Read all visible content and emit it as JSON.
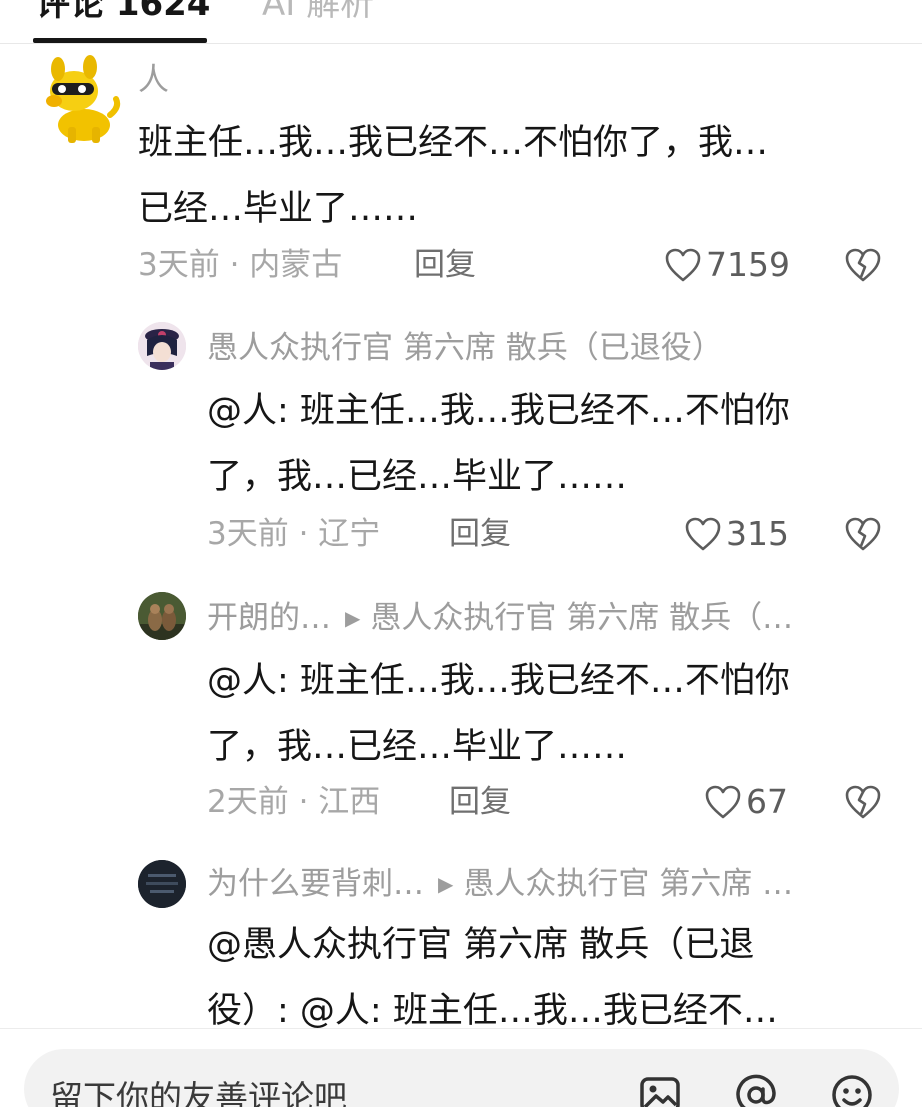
{
  "tabs": {
    "comments_label": "评论 1624",
    "ai_label": "AI 解析"
  },
  "comments": [
    {
      "username": "人",
      "text_lines": [
        "班主任…我…我已经不…不怕你了，我…",
        "已经…毕业了……"
      ],
      "time_location": "3天前 · 内蒙古",
      "reply_label": "回复",
      "likes": "7159"
    },
    {
      "username": "愚人众执行官 第六席 散兵（已退役）",
      "text_lines": [
        "@人: 班主任…我…我已经不…不怕你",
        "了，我…已经…毕业了……"
      ],
      "time_location": "3天前 · 辽宁",
      "reply_label": "回复",
      "likes": "315"
    },
    {
      "username": "开朗的…",
      "reply_to": "愚人众执行官 第六席 散兵（…",
      "text_lines": [
        "@人: 班主任…我…我已经不…不怕你",
        "了，我…已经…毕业了……"
      ],
      "time_location": "2天前 · 江西",
      "reply_label": "回复",
      "likes": "67"
    },
    {
      "username": "为什么要背刺…",
      "reply_to": "愚人众执行官 第六席 …",
      "text_lines": [
        "@愚人众执行官 第六席 散兵（已退",
        "役）: @人: 班主任…我…我已经不…"
      ]
    }
  ],
  "input": {
    "placeholder": "留下你的友善评论吧"
  },
  "icons": {
    "like": "heart-outline-icon",
    "dislike": "broken-heart-icon",
    "image": "image-icon",
    "mention": "at-sign-icon",
    "emoji": "smiley-face-icon",
    "reply_arrow": "play-triangle-icon"
  },
  "colors": {
    "text_primary": "#161616",
    "text_secondary": "#9d9d9d",
    "tab_inactive": "#b9b9b9"
  }
}
